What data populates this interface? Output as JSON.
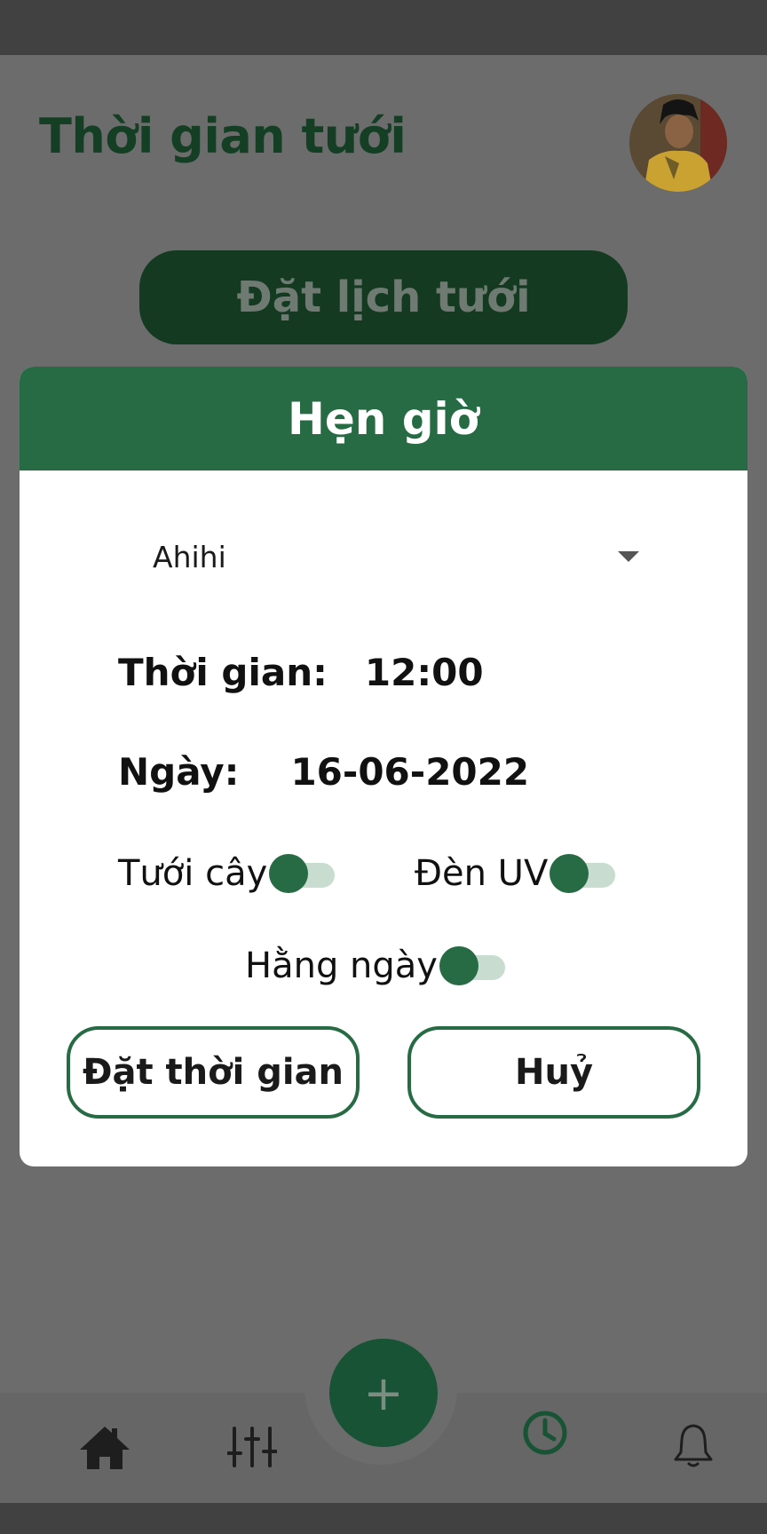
{
  "header": {
    "title": "Thời gian tưới"
  },
  "schedule_button": {
    "label": "Đặt lịch tưới"
  },
  "dialog": {
    "title": "Hẹn giờ",
    "dropdown": {
      "value": "Ahihi"
    },
    "time": {
      "label": "Thời gian:",
      "value": "12:00"
    },
    "date": {
      "label": "Ngày:",
      "value": "16-06-2022"
    },
    "toggles": {
      "watering": {
        "label": "Tưới cây",
        "on": false
      },
      "uv_light": {
        "label": "Đèn UV",
        "on": false
      },
      "daily": {
        "label": "Hằng ngày",
        "on": false
      }
    },
    "buttons": {
      "set_time": "Đặt thời gian",
      "cancel": "Huỷ"
    }
  },
  "fab": {
    "label": "+"
  },
  "bottom_nav": {
    "items": [
      {
        "icon": "home-icon"
      },
      {
        "icon": "sliders-icon"
      },
      {
        "icon": "clock-icon",
        "active": true
      },
      {
        "icon": "bell-icon"
      }
    ]
  },
  "colors": {
    "primary": "#266b43",
    "title_dark_green": "#143f24",
    "overlay_bg": "#6c6c6c",
    "switch_track": "#c8ddd0",
    "active_nav": "#175334"
  }
}
